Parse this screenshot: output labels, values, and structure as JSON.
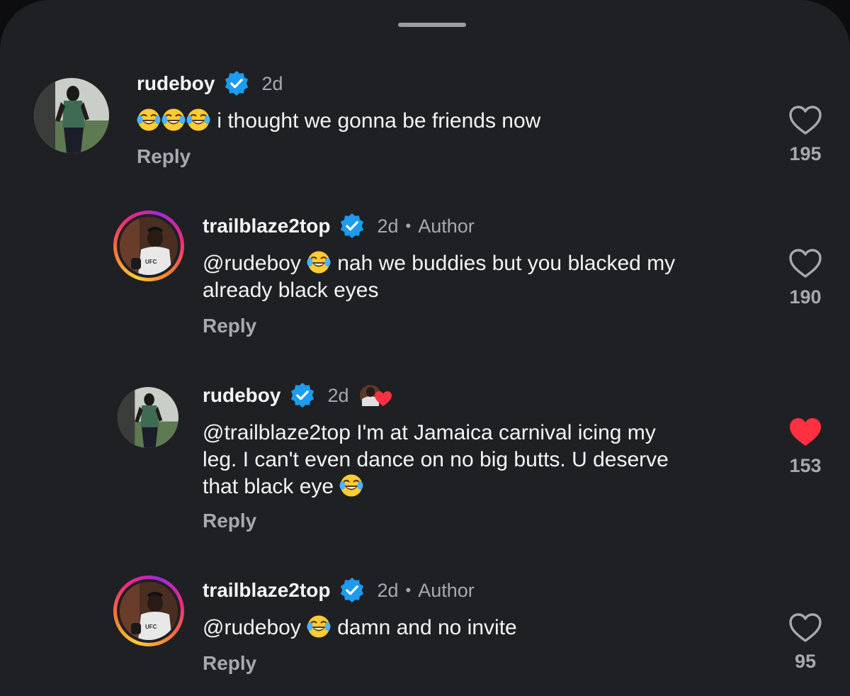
{
  "colors": {
    "background": "#1f2023",
    "text": "#f5f5f5",
    "muted": "#a8a8ad",
    "verified": "#1d9bf0",
    "liked_heart": "#ff3040",
    "story_ring": "#ee2a7b"
  },
  "comments": [
    {
      "username": "rudeboy",
      "time": "2d",
      "author_label": "",
      "mention": "",
      "emoji_prefix": [
        "face-with-tears-of-joy",
        "face-with-tears-of-joy",
        "face-with-tears-of-joy"
      ],
      "text": " i thought we gonna be friends now",
      "reply_label": "Reply",
      "likes": "195",
      "liked": false
    },
    {
      "username": "trailblaze2top",
      "time": "2d",
      "author_label": "Author",
      "mention": "@rudeboy",
      "text_line1": " nah we buddies but you blacked my",
      "text_line2": "already black eyes",
      "reply_label": "Reply",
      "likes": "190",
      "liked": false
    },
    {
      "username": "rudeboy",
      "time": "2d",
      "author_label": "",
      "mention": "@trailblaze2top",
      "text_line1": " I'm at Jamaica carnival icing my",
      "text_line2": "leg. I can't even dance on no big butts. U deserve",
      "text_line3": "that black eye ",
      "reply_label": "Reply",
      "likes": "153",
      "liked": true,
      "liked_by_author_icon": "author-liked-heart-icon"
    },
    {
      "username": "trailblaze2top",
      "time": "2d",
      "author_label": "Author",
      "mention": "@rudeboy",
      "text": " damn and no invite",
      "reply_label": "Reply",
      "likes": "95",
      "liked": false
    }
  ],
  "separator": "•"
}
